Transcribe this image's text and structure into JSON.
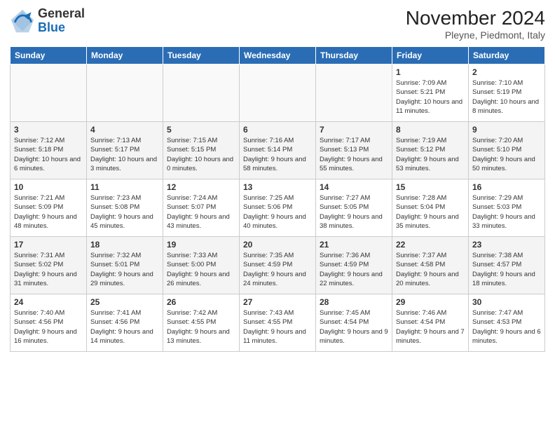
{
  "logo": {
    "general": "General",
    "blue": "Blue"
  },
  "header": {
    "month": "November 2024",
    "location": "Pleyne, Piedmont, Italy"
  },
  "weekdays": [
    "Sunday",
    "Monday",
    "Tuesday",
    "Wednesday",
    "Thursday",
    "Friday",
    "Saturday"
  ],
  "weeks": [
    {
      "days": [
        {
          "num": "",
          "info": ""
        },
        {
          "num": "",
          "info": ""
        },
        {
          "num": "",
          "info": ""
        },
        {
          "num": "",
          "info": ""
        },
        {
          "num": "",
          "info": ""
        },
        {
          "num": "1",
          "info": "Sunrise: 7:09 AM\nSunset: 5:21 PM\nDaylight: 10 hours and 11 minutes."
        },
        {
          "num": "2",
          "info": "Sunrise: 7:10 AM\nSunset: 5:19 PM\nDaylight: 10 hours and 8 minutes."
        }
      ]
    },
    {
      "days": [
        {
          "num": "3",
          "info": "Sunrise: 7:12 AM\nSunset: 5:18 PM\nDaylight: 10 hours and 6 minutes."
        },
        {
          "num": "4",
          "info": "Sunrise: 7:13 AM\nSunset: 5:17 PM\nDaylight: 10 hours and 3 minutes."
        },
        {
          "num": "5",
          "info": "Sunrise: 7:15 AM\nSunset: 5:15 PM\nDaylight: 10 hours and 0 minutes."
        },
        {
          "num": "6",
          "info": "Sunrise: 7:16 AM\nSunset: 5:14 PM\nDaylight: 9 hours and 58 minutes."
        },
        {
          "num": "7",
          "info": "Sunrise: 7:17 AM\nSunset: 5:13 PM\nDaylight: 9 hours and 55 minutes."
        },
        {
          "num": "8",
          "info": "Sunrise: 7:19 AM\nSunset: 5:12 PM\nDaylight: 9 hours and 53 minutes."
        },
        {
          "num": "9",
          "info": "Sunrise: 7:20 AM\nSunset: 5:10 PM\nDaylight: 9 hours and 50 minutes."
        }
      ]
    },
    {
      "days": [
        {
          "num": "10",
          "info": "Sunrise: 7:21 AM\nSunset: 5:09 PM\nDaylight: 9 hours and 48 minutes."
        },
        {
          "num": "11",
          "info": "Sunrise: 7:23 AM\nSunset: 5:08 PM\nDaylight: 9 hours and 45 minutes."
        },
        {
          "num": "12",
          "info": "Sunrise: 7:24 AM\nSunset: 5:07 PM\nDaylight: 9 hours and 43 minutes."
        },
        {
          "num": "13",
          "info": "Sunrise: 7:25 AM\nSunset: 5:06 PM\nDaylight: 9 hours and 40 minutes."
        },
        {
          "num": "14",
          "info": "Sunrise: 7:27 AM\nSunset: 5:05 PM\nDaylight: 9 hours and 38 minutes."
        },
        {
          "num": "15",
          "info": "Sunrise: 7:28 AM\nSunset: 5:04 PM\nDaylight: 9 hours and 35 minutes."
        },
        {
          "num": "16",
          "info": "Sunrise: 7:29 AM\nSunset: 5:03 PM\nDaylight: 9 hours and 33 minutes."
        }
      ]
    },
    {
      "days": [
        {
          "num": "17",
          "info": "Sunrise: 7:31 AM\nSunset: 5:02 PM\nDaylight: 9 hours and 31 minutes."
        },
        {
          "num": "18",
          "info": "Sunrise: 7:32 AM\nSunset: 5:01 PM\nDaylight: 9 hours and 29 minutes."
        },
        {
          "num": "19",
          "info": "Sunrise: 7:33 AM\nSunset: 5:00 PM\nDaylight: 9 hours and 26 minutes."
        },
        {
          "num": "20",
          "info": "Sunrise: 7:35 AM\nSunset: 4:59 PM\nDaylight: 9 hours and 24 minutes."
        },
        {
          "num": "21",
          "info": "Sunrise: 7:36 AM\nSunset: 4:59 PM\nDaylight: 9 hours and 22 minutes."
        },
        {
          "num": "22",
          "info": "Sunrise: 7:37 AM\nSunset: 4:58 PM\nDaylight: 9 hours and 20 minutes."
        },
        {
          "num": "23",
          "info": "Sunrise: 7:38 AM\nSunset: 4:57 PM\nDaylight: 9 hours and 18 minutes."
        }
      ]
    },
    {
      "days": [
        {
          "num": "24",
          "info": "Sunrise: 7:40 AM\nSunset: 4:56 PM\nDaylight: 9 hours and 16 minutes."
        },
        {
          "num": "25",
          "info": "Sunrise: 7:41 AM\nSunset: 4:56 PM\nDaylight: 9 hours and 14 minutes."
        },
        {
          "num": "26",
          "info": "Sunrise: 7:42 AM\nSunset: 4:55 PM\nDaylight: 9 hours and 13 minutes."
        },
        {
          "num": "27",
          "info": "Sunrise: 7:43 AM\nSunset: 4:55 PM\nDaylight: 9 hours and 11 minutes."
        },
        {
          "num": "28",
          "info": "Sunrise: 7:45 AM\nSunset: 4:54 PM\nDaylight: 9 hours and 9 minutes."
        },
        {
          "num": "29",
          "info": "Sunrise: 7:46 AM\nSunset: 4:54 PM\nDaylight: 9 hours and 7 minutes."
        },
        {
          "num": "30",
          "info": "Sunrise: 7:47 AM\nSunset: 4:53 PM\nDaylight: 9 hours and 6 minutes."
        }
      ]
    }
  ]
}
